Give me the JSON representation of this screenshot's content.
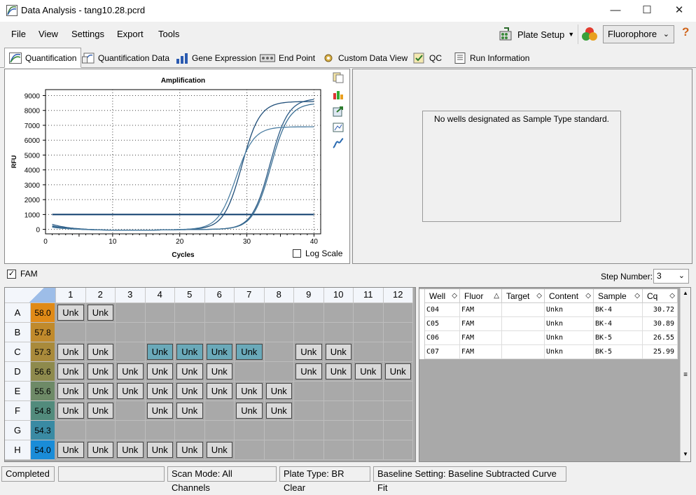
{
  "window": {
    "title": "Data Analysis - tang10.28.pcrd"
  },
  "menu": {
    "file": "File",
    "view": "View",
    "settings": "Settings",
    "export": "Export",
    "tools": "Tools"
  },
  "toolbar": {
    "plate_setup": "Plate Setup",
    "fluorophore": "Fluorophore"
  },
  "tabs": [
    "Quantification",
    "Quantification Data",
    "Gene Expression",
    "End Point",
    "Custom Data View",
    "QC",
    "Run Information"
  ],
  "chart_data": {
    "type": "line",
    "title": "Amplification",
    "xlabel": "Cycles",
    "ylabel": "RFU",
    "xlim": [
      0,
      41
    ],
    "ylim": [
      -300,
      9400
    ],
    "xticks": [
      0,
      10,
      20,
      30,
      40
    ],
    "yticks": [
      0,
      1000,
      2000,
      3000,
      4000,
      5000,
      6000,
      7000,
      8000,
      9000
    ],
    "threshold": 1000,
    "series": [
      {
        "name": "C04",
        "cq": 30.72,
        "plateau": 8800,
        "color": "#2a5a86",
        "start": 350
      },
      {
        "name": "C05",
        "cq": 30.89,
        "plateau": 8500,
        "color": "#3b6f94",
        "start": 250
      },
      {
        "name": "C06",
        "cq": 26.55,
        "plateau": 8600,
        "color": "#1f4e79",
        "start": 200
      },
      {
        "name": "C07",
        "cq": 25.99,
        "plateau": 6900,
        "color": "#4d7fa3",
        "start": 150
      }
    ],
    "log_scale_label": "Log Scale",
    "log_scale_checked": false
  },
  "standard_msg": "No wells designated as Sample Type standard.",
  "fluor_checkbox": {
    "label": "FAM",
    "checked": true
  },
  "step": {
    "label": "Step Number:",
    "value": "3"
  },
  "plate": {
    "cols": [
      "1",
      "2",
      "3",
      "4",
      "5",
      "6",
      "7",
      "8",
      "9",
      "10",
      "11",
      "12"
    ],
    "rows": [
      {
        "label": "A",
        "temp": "58.0",
        "color": "#e08a17",
        "wells": [
          "Unk",
          "Unk",
          "",
          "",
          "",
          "",
          "",
          "",
          "",
          "",
          "",
          ""
        ]
      },
      {
        "label": "B",
        "temp": "57.8",
        "color": "#c08a2c",
        "wells": [
          "",
          "",
          "",
          "",
          "",
          "",
          "",
          "",
          "",
          "",
          "",
          ""
        ]
      },
      {
        "label": "C",
        "temp": "57.3",
        "color": "#a98a3b",
        "wells": [
          "Unk",
          "Unk",
          "",
          "Unk*",
          "Unk*",
          "Unk*",
          "Unk*",
          "",
          "Unk",
          "Unk",
          "",
          ""
        ]
      },
      {
        "label": "D",
        "temp": "56.6",
        "color": "#8e8a4d",
        "wells": [
          "Unk",
          "Unk",
          "Unk",
          "Unk",
          "Unk",
          "Unk",
          "",
          "",
          "Unk",
          "Unk",
          "Unk",
          "Unk"
        ]
      },
      {
        "label": "E",
        "temp": "55.6",
        "color": "#6e8a67",
        "wells": [
          "Unk",
          "Unk",
          "Unk",
          "Unk",
          "Unk",
          "Unk",
          "Unk",
          "Unk",
          "",
          "",
          "",
          ""
        ]
      },
      {
        "label": "F",
        "temp": "54.8",
        "color": "#528b7c",
        "wells": [
          "Unk",
          "Unk",
          "",
          "Unk",
          "Unk",
          "",
          "Unk",
          "Unk",
          "",
          "",
          "",
          ""
        ]
      },
      {
        "label": "G",
        "temp": "54.3",
        "color": "#3a8aa3",
        "wells": [
          "",
          "",
          "",
          "",
          "",
          "",
          "",
          "",
          "",
          "",
          "",
          ""
        ]
      },
      {
        "label": "H",
        "temp": "54.0",
        "color": "#1a8cd8",
        "wells": [
          "Unk",
          "Unk",
          "Unk",
          "Unk",
          "Unk",
          "Unk",
          "",
          "",
          "",
          "",
          "",
          ""
        ]
      }
    ]
  },
  "table": {
    "headers": [
      "Well",
      "Fluor",
      "Target",
      "Content",
      "Sample",
      "Cq"
    ],
    "rows": [
      [
        "C04",
        "FAM",
        "",
        "Unkn",
        "BK-4",
        "30.72"
      ],
      [
        "C05",
        "FAM",
        "",
        "Unkn",
        "BK-4",
        "30.89"
      ],
      [
        "C06",
        "FAM",
        "",
        "Unkn",
        "BK-5",
        "26.55"
      ],
      [
        "C07",
        "FAM",
        "",
        "Unkn",
        "BK-5",
        "25.99"
      ]
    ]
  },
  "status": {
    "state": "Completed",
    "scan_mode": "Scan Mode: All Channels",
    "plate_type": "Plate Type: BR Clear",
    "baseline": "Baseline Setting: Baseline Subtracted Curve Fit"
  }
}
